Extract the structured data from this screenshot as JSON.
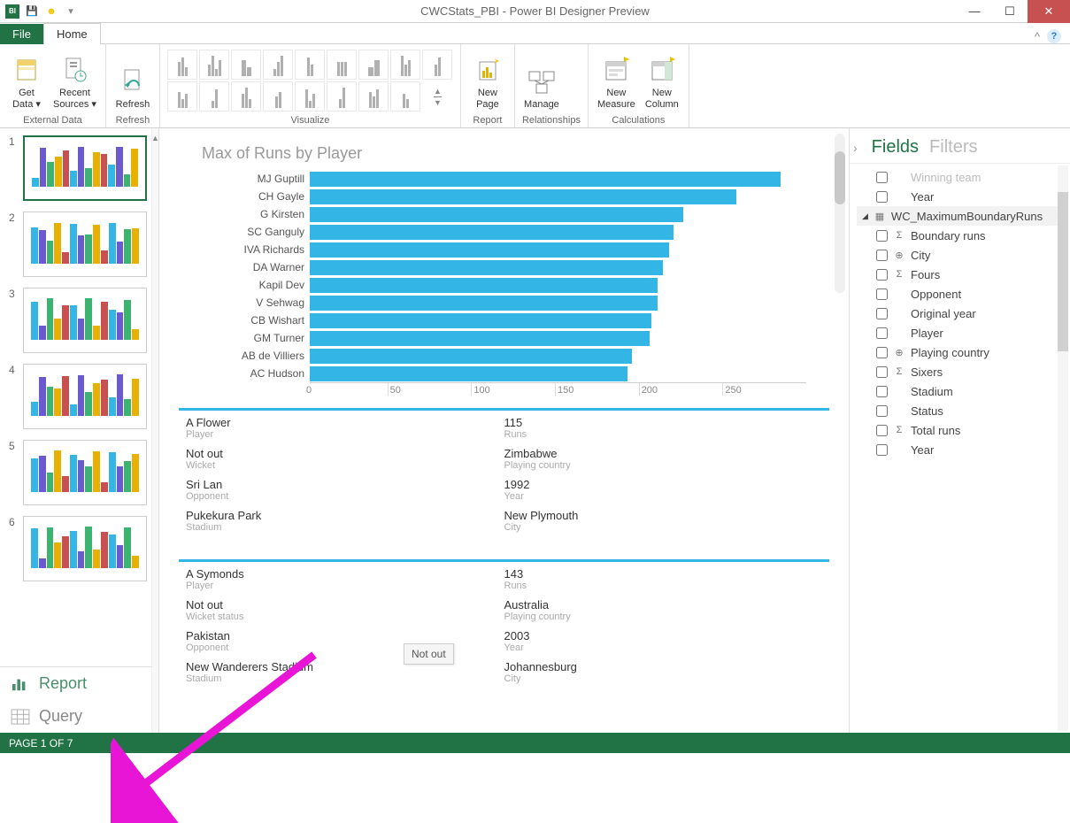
{
  "title": "CWCStats_PBI - Power BI Designer Preview",
  "tabs": {
    "file": "File",
    "home": "Home"
  },
  "ribbon": {
    "get_data": "Get\nData ▾",
    "recent_sources": "Recent\nSources ▾",
    "refresh": "Refresh",
    "new_page": "New\nPage",
    "manage": "Manage",
    "new_measure": "New\nMeasure",
    "new_column": "New\nColumn",
    "grp_external": "External Data",
    "grp_refresh": "Refresh",
    "grp_visualize": "Visualize",
    "grp_report": "Report",
    "grp_relationships": "Relationships",
    "grp_calculations": "Calculations"
  },
  "thumbs": [
    "1",
    "2",
    "3",
    "4",
    "5",
    "6"
  ],
  "mode": {
    "report": "Report",
    "query": "Query"
  },
  "chart_data": {
    "type": "bar",
    "title": "Max of Runs by Player",
    "xlabel": "",
    "ylabel": "",
    "ticks": [
      "0",
      "50",
      "100",
      "150",
      "200",
      "250"
    ],
    "xlim": [
      0,
      250
    ],
    "categories": [
      "MJ Guptill",
      "CH Gayle",
      "G Kirsten",
      "SC Ganguly",
      "IVA Richards",
      "DA Warner",
      "Kapil Dev",
      "V Sehwag",
      "CB Wishart",
      "GM Turner",
      "AB de Villiers",
      "AC Hudson"
    ],
    "values": [
      237,
      215,
      188,
      183,
      181,
      178,
      175,
      175,
      172,
      171,
      162,
      160
    ]
  },
  "cards": [
    {
      "rows": [
        {
          "v1": "A Flower",
          "l1": "Player",
          "v2": "115",
          "l2": "Runs"
        },
        {
          "v1": "Not out",
          "l1": "Wicket",
          "v2": "Zimbabwe",
          "l2": "Playing country"
        },
        {
          "v1": "Sri Lan",
          "l1": "Opponent",
          "v2": "1992",
          "l2": "Year"
        },
        {
          "v1": "Pukekura Park",
          "l1": "Stadium",
          "v2": "New Plymouth",
          "l2": "City"
        }
      ]
    },
    {
      "rows": [
        {
          "v1": "A Symonds",
          "l1": "Player",
          "v2": "143",
          "l2": "Runs"
        },
        {
          "v1": "Not out",
          "l1": "Wicket status",
          "v2": "Australia",
          "l2": "Playing country"
        },
        {
          "v1": "Pakistan",
          "l1": "Opponent",
          "v2": "2003",
          "l2": "Year"
        },
        {
          "v1": "New Wanderers Stadium",
          "l1": "Stadium",
          "v2": "Johannesburg",
          "l2": "City"
        }
      ]
    }
  ],
  "tooltip": "Not out",
  "fields_pane": {
    "fields": "Fields",
    "filters": "Filters",
    "truncated_top": "Winning team",
    "year_top": "Year",
    "table": "WC_MaximumBoundaryRuns",
    "items": [
      {
        "icon": "Σ",
        "label": "Boundary runs"
      },
      {
        "icon": "⊕",
        "label": "City"
      },
      {
        "icon": "Σ",
        "label": "Fours"
      },
      {
        "icon": "",
        "label": "Opponent"
      },
      {
        "icon": "",
        "label": "Original year"
      },
      {
        "icon": "",
        "label": "Player"
      },
      {
        "icon": "⊕",
        "label": "Playing country"
      },
      {
        "icon": "Σ",
        "label": "Sixers"
      },
      {
        "icon": "",
        "label": "Stadium"
      },
      {
        "icon": "",
        "label": "Status"
      },
      {
        "icon": "Σ",
        "label": "Total runs"
      },
      {
        "icon": "",
        "label": "Year"
      }
    ]
  },
  "status": "PAGE 1 OF 7"
}
